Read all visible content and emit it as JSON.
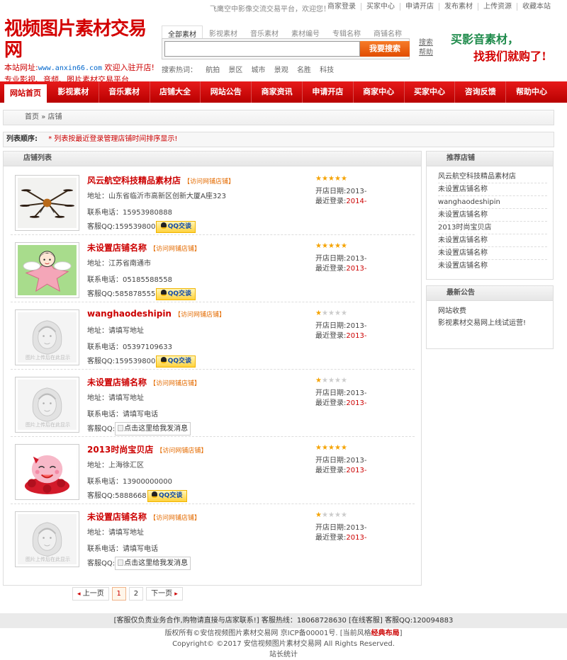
{
  "topbar": {
    "welcome": "飞鹰空中影像交流交易平台，欢迎您！",
    "links": [
      "商家登录",
      "买家中心",
      "申请开店",
      "发布素材",
      "上传资源",
      "收藏本站"
    ]
  },
  "logo": {
    "name": "视频图片素材交易网",
    "url_prefix": "本站网址:",
    "url": "www.anxin66.com",
    "url_suffix": "欢迎入驻开店!",
    "slogan": "专业影视、音频、图片素材交易平台"
  },
  "search": {
    "tabs": [
      "全部素材",
      "影视素材",
      "音乐素材",
      "素材编号",
      "专辑名称",
      "商铺名称"
    ],
    "button": "我要搜索",
    "hot_label": "搜索热词：",
    "hot_words": [
      "航拍",
      "景区",
      "城市",
      "景观",
      "名胜",
      "科技"
    ]
  },
  "advanced": {
    "line1": "搜索",
    "line2": "帮助"
  },
  "banner": {
    "line1": "买影音素材，",
    "line2": "找我们就购了!"
  },
  "nav": [
    "网站首页",
    "影视素材",
    "音乐素材",
    "店铺大全",
    "网站公告",
    "商家资讯",
    "申请开店",
    "商家中心",
    "买家中心",
    "咨询反馈",
    "帮助中心"
  ],
  "breadcrumb": {
    "home": "首页",
    "sep": "»",
    "current": "店铺"
  },
  "sort": {
    "label": "列表顺序:",
    "note": "* 列表按最近登录管理店铺时间排序显示!"
  },
  "shop_list": {
    "title": "店铺列表",
    "visit_label": "【访问网铺店铺】",
    "address_label": "地址：",
    "phone_label": "联系电话：",
    "qq_label": "客服QQ:",
    "qq_button": "QQ交谈",
    "qq_broken": "点击这里给我发消息",
    "open_label": "开店日期:",
    "last_label": "最近登录:",
    "items": [
      {
        "name": "风云航空科技精品素材店",
        "address": "山东省临沂市高新区创新大厦A座323",
        "phone": "15953980888",
        "qq": "159539800",
        "open": "2013-",
        "last": "2014-",
        "stars": 5,
        "image": "drone"
      },
      {
        "name": "未设置店铺名称",
        "address": "江苏省南通市",
        "phone": "05185588558",
        "qq": "585878555",
        "open": "2013-",
        "last": "2013-",
        "stars": 5,
        "image": "cartoon"
      },
      {
        "name": "wanghaodeshipin",
        "address": "请填写地址",
        "phone": "05397109633",
        "qq": "159539800",
        "open": "2013-",
        "last": "2013-",
        "stars": 1,
        "image": "placeholder"
      },
      {
        "name": "未设置店铺名称",
        "address": "请填写地址",
        "phone": "请填写电话",
        "qq": "",
        "open": "2013-",
        "last": "2013-",
        "stars": 1,
        "image": "placeholder"
      },
      {
        "name": "2013时尚宝贝店",
        "address": "上海徐汇区",
        "phone": "13900000000",
        "qq": "5888668",
        "open": "2013-",
        "last": "2013-",
        "stars": 5,
        "image": "pink"
      },
      {
        "name": "未设置店铺名称",
        "address": "请填写地址",
        "phone": "请填写电话",
        "qq": "",
        "open": "2013-",
        "last": "2013-",
        "stars": 1,
        "image": "placeholder"
      }
    ],
    "placeholder_text": "图片上传后在此显示"
  },
  "pager": {
    "prev": "上一页",
    "pages": [
      "1",
      "2"
    ],
    "current": "1",
    "next": "下一页"
  },
  "recommend": {
    "title": "推荐店铺",
    "items": [
      "风云航空科技精品素材店",
      "未设置店铺名称",
      "wanghaodeshipin",
      "未设置店铺名称",
      "2013时尚宝贝店",
      "未设置店铺名称",
      "未设置店铺名称",
      "未设置店铺名称"
    ]
  },
  "news": {
    "title": "最新公告",
    "items": [
      "网站收费",
      "影视素材交易网上线试运营!"
    ]
  },
  "footer": {
    "bar": "[客服仅负责业务合作,购物请直接与店家联系!]  客服热线：18068728630 [在线客服] 客服QQ:120094883",
    "line1_prefix": "版权所有©安信视频图片素材交易网 京ICP备00001号. [当前风格",
    "line1_style": "经典布局",
    "line1_suffix": "]",
    "line2": "Copyright© ©2017  安信视频图片素材交易网  All Rights Reserved.",
    "line3": "站长统计"
  },
  "colors": {
    "brand": "#d30000",
    "nav": "#c80000",
    "accent_orange": "#e46b00",
    "star": "#f5a300"
  },
  "icons": {
    "star": "star-icon",
    "qq": "qq-penguin-icon",
    "arrow": "arrow-icon"
  }
}
